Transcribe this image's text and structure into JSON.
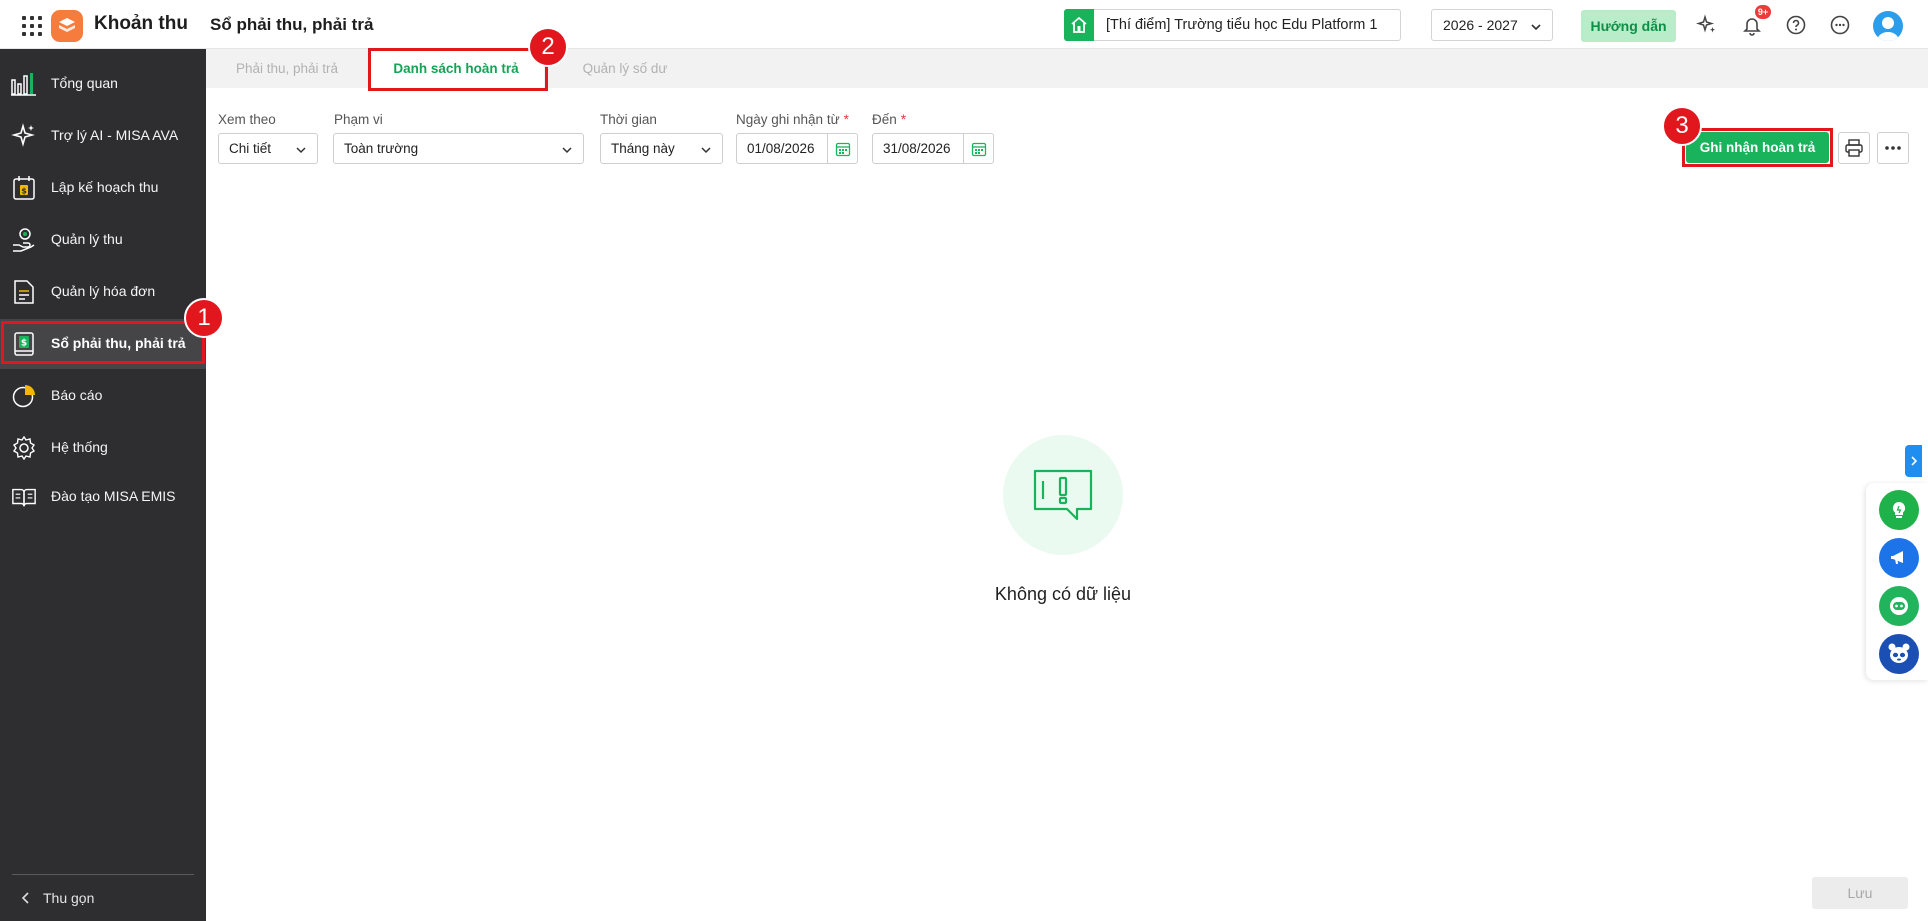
{
  "header": {
    "app_name": "Khoản thu",
    "page_title": "Sổ phải thu, phải trả",
    "school_name": "[Thí điểm] Trường tiểu học Edu Platform 1",
    "school_year": "2026 - 2027",
    "guide_label": "Hướng dẫn",
    "notification_badge": "9+"
  },
  "sidebar": {
    "items": [
      {
        "label": "Tổng quan",
        "icon": "bar-chart-icon"
      },
      {
        "label": "Trợ lý AI - MISA AVA",
        "icon": "sparkle-icon"
      },
      {
        "label": "Lập kế hoạch thu",
        "icon": "calendar-money-icon"
      },
      {
        "label": "Quản lý thu",
        "icon": "hand-coin-icon"
      },
      {
        "label": "Quản lý hóa đơn",
        "icon": "invoice-icon"
      },
      {
        "label": "Sổ phải thu, phải trả",
        "icon": "ledger-icon",
        "active": true
      },
      {
        "label": "Báo cáo",
        "icon": "pie-chart-icon"
      },
      {
        "label": "Hệ thống",
        "icon": "gear-icon"
      },
      {
        "label": "Đào tạo MISA EMIS",
        "icon": "book-icon"
      }
    ],
    "collapse_label": "Thu gọn"
  },
  "tabs": [
    {
      "label": "Phải thu, phải trả",
      "active": false
    },
    {
      "label": "Danh sách hoàn trả",
      "active": true
    },
    {
      "label": "Quản lý số dư",
      "active": false
    }
  ],
  "filters": {
    "view_by": {
      "label": "Xem theo",
      "value": "Chi tiết"
    },
    "scope": {
      "label": "Phạm vi",
      "value": "Toàn trường"
    },
    "period": {
      "label": "Thời gian",
      "value": "Tháng này"
    },
    "date_from": {
      "label": "Ngày ghi nhận từ",
      "required_mark": "*",
      "value": "01/08/2026"
    },
    "date_to": {
      "label": "Đến",
      "required_mark": "*",
      "value": "31/08/2026"
    }
  },
  "actions": {
    "record_refund_label": "Ghi nhận hoàn trả",
    "save_label": "Lưu"
  },
  "empty_state": {
    "message": "Không có dữ liệu"
  },
  "annotations": {
    "step1": "1",
    "step2": "2",
    "step3": "3"
  },
  "colors": {
    "primary": "#19b35c",
    "sidebar_bg": "#2e2e30",
    "annotation": "#e2171d"
  }
}
